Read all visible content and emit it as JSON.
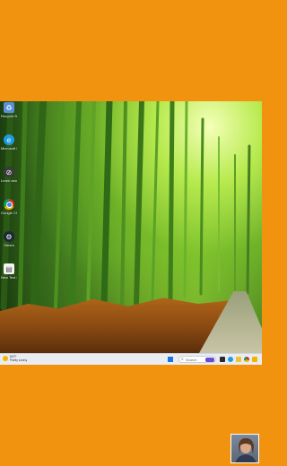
{
  "desktop": {
    "icons": [
      {
        "name": "recycle-bin-icon",
        "label": "Recycle Bin",
        "color": "#5b8fd6",
        "glyph": "♻"
      },
      {
        "name": "edge-icon",
        "label": "Microsoft Edge",
        "color": "#1f9be0",
        "glyph": "e"
      },
      {
        "name": "shortcut-icon",
        "label": "Learn about this picture",
        "color": "#3a3a3a",
        "glyph": "⊘"
      },
      {
        "name": "chrome-icon",
        "label": "Google Chrome",
        "color": "#d93025",
        "glyph": "◉"
      },
      {
        "name": "steam-icon",
        "label": "Steam",
        "color": "#1b2838",
        "glyph": "⚙"
      },
      {
        "name": "file-icon",
        "label": "New Text Document",
        "color": "#f5f5f5",
        "glyph": "▤"
      }
    ]
  },
  "taskbar": {
    "weather_temp": "84°F",
    "weather_desc": "Partly sunny",
    "search_placeholder": "Search",
    "search_icon": "magnifier"
  }
}
